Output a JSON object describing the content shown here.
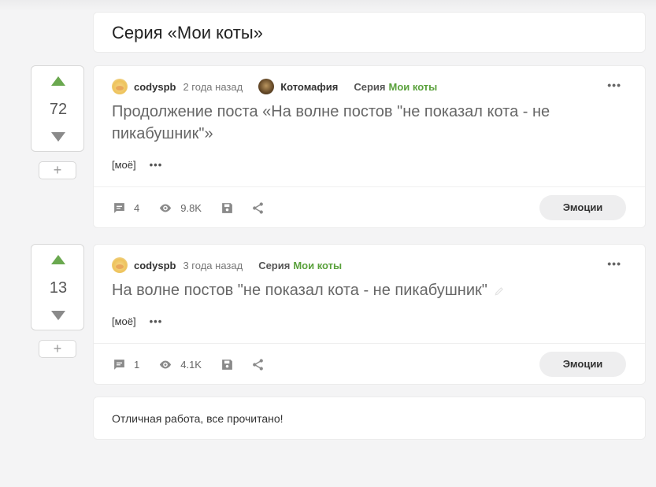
{
  "series": {
    "title": "Серия «Мои коты»"
  },
  "posts": [
    {
      "score": "72",
      "author": "codyspb",
      "time": "2 года назад",
      "community": "Котомафия",
      "series_label": "Серия",
      "series_name": "Мои коты",
      "title": "Продолжение поста «На волне постов \"не показал кота - не пикабушник\"»",
      "tag": "[моё]",
      "comments": "4",
      "views": "9.8K",
      "emotions": "Эмоции"
    },
    {
      "score": "13",
      "author": "codyspb",
      "time": "3 года назад",
      "series_label": "Серия",
      "series_name": "Мои коты",
      "title": "На волне постов \"не показал кота - не пикабушник\"",
      "tag": "[моё]",
      "comments": "1",
      "views": "4.1K",
      "emotions": "Эмоции"
    }
  ],
  "vote": {
    "add": "+"
  },
  "more": "•••",
  "footer_message": "Отличная работа, все прочитано!",
  "colors": {
    "upvote": "#6aa84f",
    "series_link": "#5aa13c"
  },
  "icons": [
    "arrow-up-icon",
    "arrow-down-icon",
    "comment-icon",
    "eye-icon",
    "save-icon",
    "share-icon",
    "more-icon",
    "edit-icon"
  ]
}
